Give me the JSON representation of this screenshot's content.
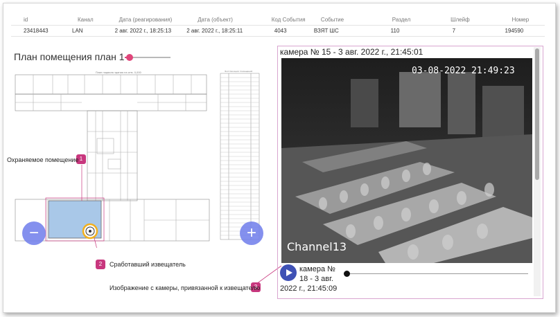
{
  "table": {
    "headers": [
      "id",
      "Канал",
      "Дата (реагирования)",
      "Дата (объект)",
      "Код События",
      "Событие",
      "Раздел",
      "Шлейф",
      "Номер"
    ],
    "row": [
      "23418443",
      "LAN",
      "2 авг. 2022 г., 18:25:13",
      "2 авг. 2022 г., 18:25:11",
      "4043",
      "ВЗЯТ ШС",
      "110",
      "7",
      "194590"
    ]
  },
  "plan": {
    "title": "План помещения план 1",
    "slider_value": 0.1,
    "drawing_header": "План подвала здания на отм. 0,000",
    "legend_header": "Экспликация помещений",
    "zoom_out_label": "−",
    "zoom_in_label": "+"
  },
  "callouts": [
    {
      "number": "1",
      "label": "Охраняемое помещение"
    },
    {
      "number": "2",
      "label": "Сработавший извещатель"
    },
    {
      "number": "3",
      "label": "Изображение с камеры, привязанной к извещателю"
    }
  ],
  "camera": {
    "title": "камера № 15 - 3 авг. 2022 г., 21:45:01",
    "osd_timestamp": "03-08-2022 21:49:23",
    "osd_channel": "Channel13",
    "next_line1": "камера №",
    "next_line2": "18 - 3 авг.",
    "next_line3": "2022 г., 21:45:09",
    "progress": 0.0
  },
  "colors": {
    "accent_pink": "#e0457a",
    "badge": "#c8377e",
    "fab": "#6e7deb",
    "play": "#3f51b5",
    "room_fill": "#a9c8e8"
  }
}
